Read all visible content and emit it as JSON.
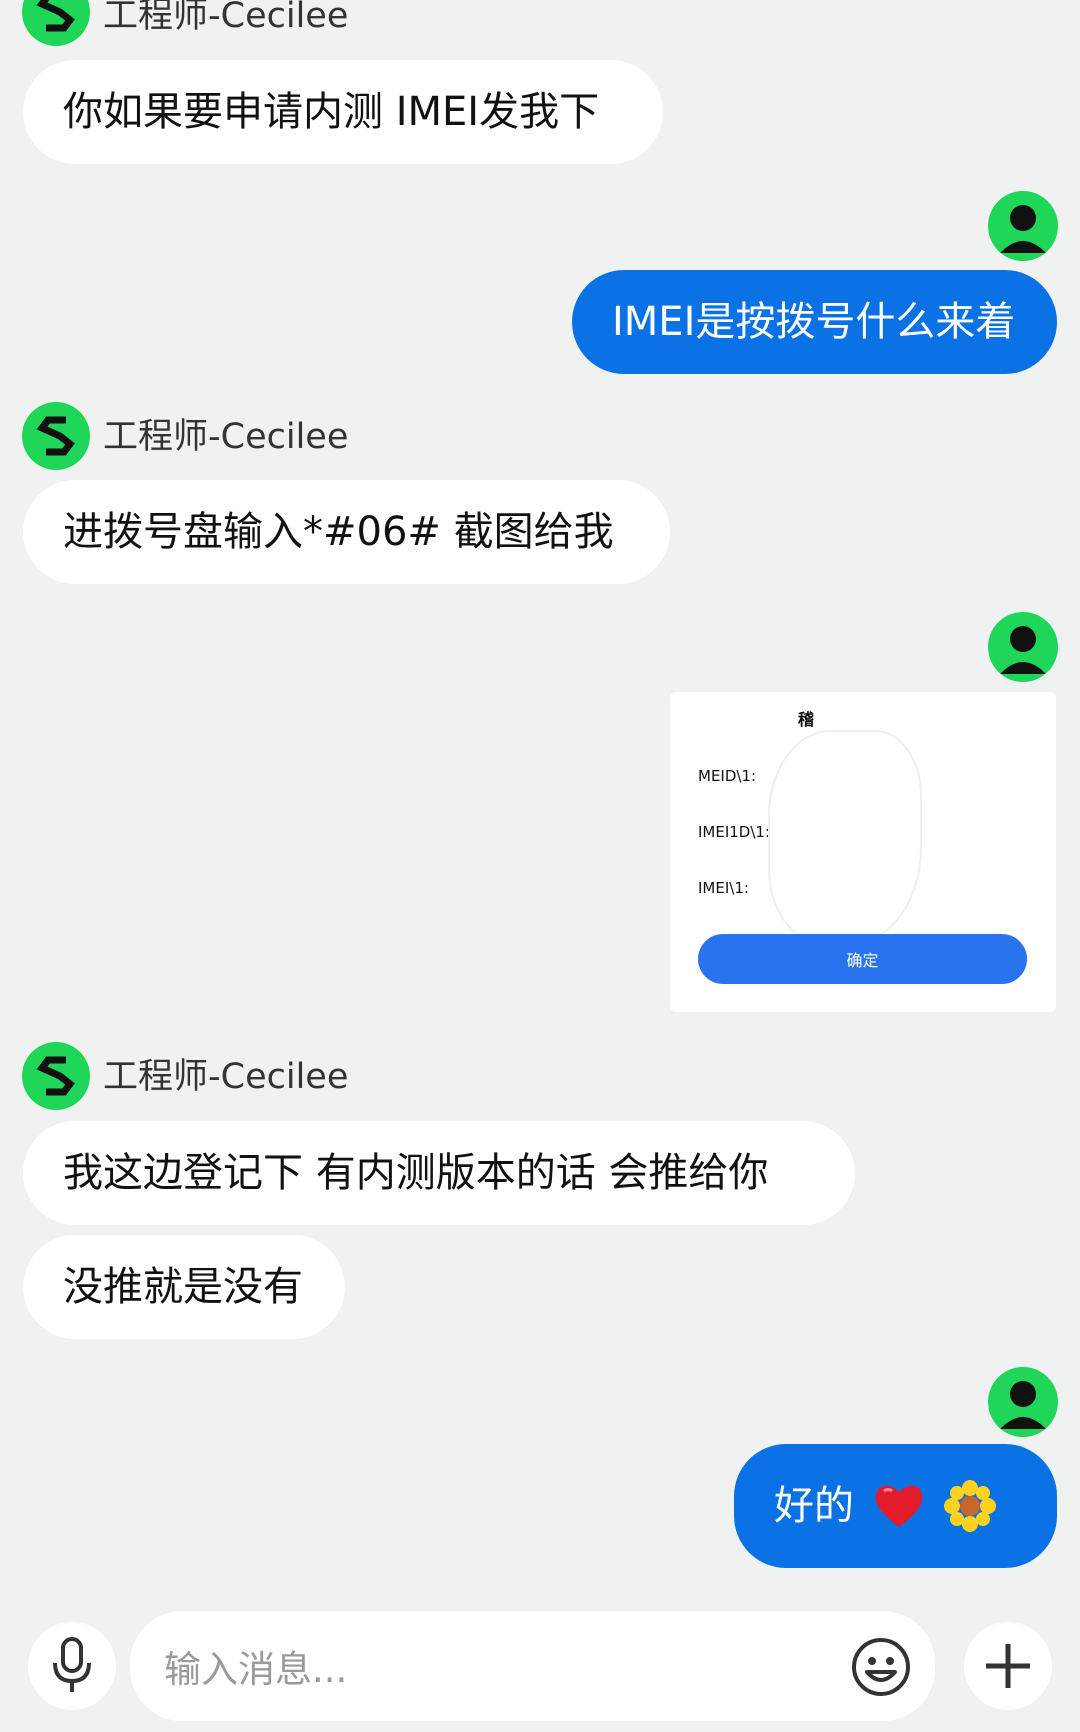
{
  "colors": {
    "background": "#f0f2f2",
    "accent_green": "#1fd659",
    "outgoing_bubble": "#0a72e4",
    "dialog_button": "#2a73ee"
  },
  "messages": [
    {
      "from": "agent",
      "sender": "工程师-Cecilee",
      "text": "你如果要申请内测  IMEI发我下"
    },
    {
      "from": "me",
      "text": "IMEI是按拨号什么来着"
    },
    {
      "from": "agent",
      "sender": "工程师-Cecilee",
      "text": "进拨号盘输入*#06#    截图给我"
    },
    {
      "from": "me",
      "type": "image",
      "screenshot": {
        "title": "稽",
        "rows": [
          "MEID\\1:",
          "IMEI1D\\1:",
          "IMEI\\1:"
        ],
        "confirm_label": "确定"
      }
    },
    {
      "from": "agent",
      "sender": "工程师-Cecilee",
      "text": "我这边登记下  有内测版本的话  会推给你"
    },
    {
      "from": "agent",
      "text": "没推就是没有"
    },
    {
      "from": "me",
      "text": "好的",
      "emojis": [
        "heart-emoji",
        "sunflower-emoji"
      ]
    }
  ],
  "composer": {
    "placeholder": "输入消息...",
    "icons": [
      "microphone-icon",
      "emoji-icon",
      "plus-icon"
    ]
  }
}
